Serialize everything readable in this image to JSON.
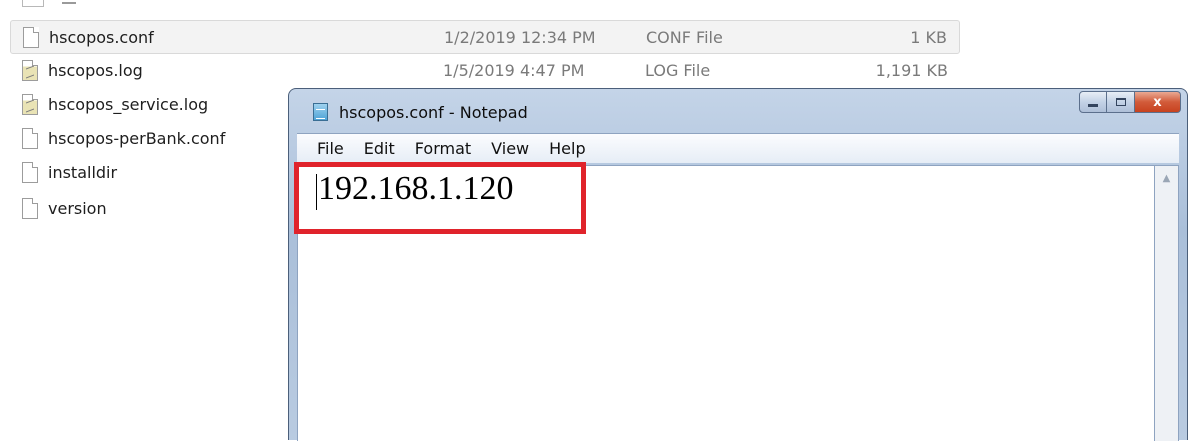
{
  "explorer": {
    "files": [
      {
        "name": "hscopos.conf",
        "date": "1/2/2019 12:34 PM",
        "type": "CONF File",
        "size": "1 KB",
        "icon": "conf-file-icon",
        "selected": true
      },
      {
        "name": "hscopos.log",
        "date": "1/5/2019 4:47 PM",
        "type": "LOG File",
        "size": "1,191 KB",
        "icon": "log-file-icon",
        "selected": false
      },
      {
        "name": "hscopos_service.log",
        "date": "",
        "type": "",
        "size": "",
        "icon": "log-file-icon",
        "selected": false
      },
      {
        "name": "hscopos-perBank.conf",
        "date": "",
        "type": "",
        "size": "",
        "icon": "conf-file-icon",
        "selected": false
      },
      {
        "name": "installdir",
        "date": "",
        "type": "",
        "size": "",
        "icon": "file-icon",
        "selected": false
      },
      {
        "name": "version",
        "date": "",
        "type": "",
        "size": "",
        "icon": "file-icon",
        "selected": false
      }
    ]
  },
  "notepad": {
    "title": "hscopos.conf - Notepad",
    "close_label": "x",
    "menu": [
      {
        "label": "File"
      },
      {
        "label": "Edit"
      },
      {
        "label": "Format"
      },
      {
        "label": "View"
      },
      {
        "label": "Help"
      }
    ],
    "content": "192.168.1.120",
    "highlight_color": "#e0232b"
  }
}
